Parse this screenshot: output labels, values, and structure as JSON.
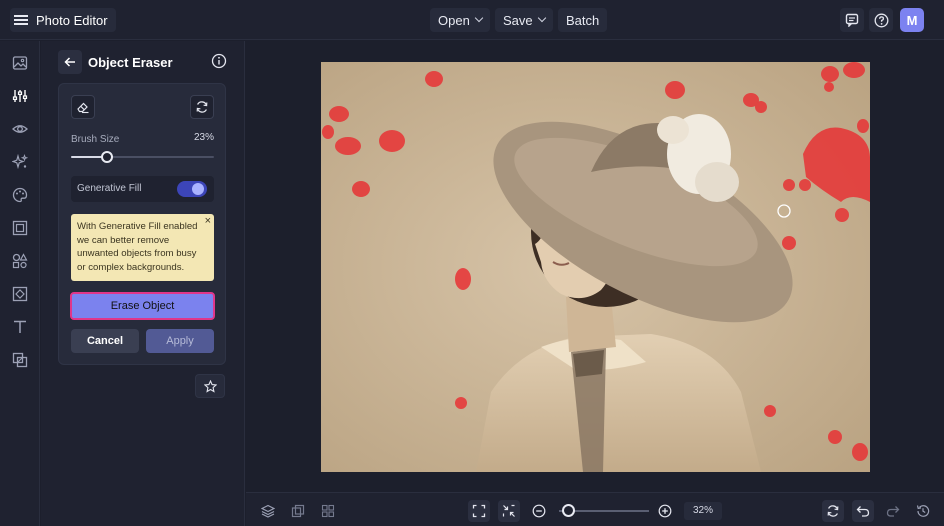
{
  "app": {
    "title": "Photo Editor",
    "menu_icon": "hamburger-icon",
    "avatar_initial": "M",
    "avatar_color": "#7c82f0"
  },
  "top_menu": {
    "open": "Open",
    "save": "Save",
    "batch": "Batch"
  },
  "top_icons": [
    "feedback-icon",
    "help-icon"
  ],
  "rail_icons": [
    "image-icon",
    "adjust-sliders-icon",
    "eye-icon",
    "sparkle-icon",
    "palette-icon",
    "frame-icon",
    "shapes-icon",
    "texture-icon",
    "text-icon",
    "layers-icon"
  ],
  "panel": {
    "title": "Object Eraser",
    "brush_size_label": "Brush Size",
    "brush_size_value": "23%",
    "brush_size_fraction": 0.25,
    "generative_fill_label": "Generative Fill",
    "generative_fill_on": true,
    "note": "With Generative Fill enabled we can better remove unwanted objects from busy or complex backgrounds.",
    "note_close": "×",
    "erase_button": "Erase Object",
    "cancel_button": "Cancel",
    "apply_button": "Apply"
  },
  "colors": {
    "accent": "#7b82ee",
    "highlight_border": "#e0368a",
    "brush_mark": "#e53a3a",
    "note_bg": "#f3e7b4"
  },
  "bottom": {
    "zoom_value": "32%",
    "zoom_fraction": 0.1
  }
}
